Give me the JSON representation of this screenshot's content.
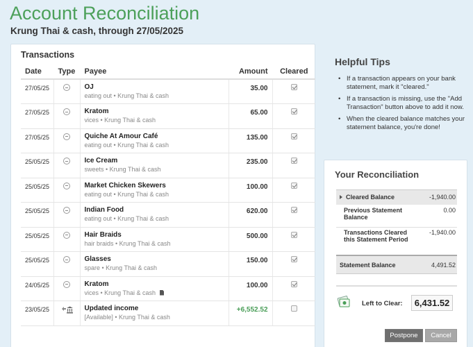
{
  "page": {
    "title": "Account Reconciliation",
    "subtitle": "Krung Thai & cash, through 27/05/2025"
  },
  "transactions": {
    "heading": "Transactions",
    "columns": {
      "date": "Date",
      "type": "Type",
      "payee": "Payee",
      "amount": "Amount",
      "cleared": "Cleared"
    },
    "rows": [
      {
        "date": "27/05/25",
        "type_icon": "minus-circle-icon",
        "payee": "OJ",
        "meta": "eating out • Krung Thai & cash",
        "amount": "35.00",
        "cleared": true
      },
      {
        "date": "27/05/25",
        "type_icon": "minus-circle-icon",
        "payee": "Kratom",
        "meta": "vices • Krung Thai & cash",
        "amount": "65.00",
        "cleared": true
      },
      {
        "date": "27/05/25",
        "type_icon": "minus-circle-icon",
        "payee": "Quiche At Amour Café",
        "meta": "eating out • Krung Thai & cash",
        "amount": "135.00",
        "cleared": true
      },
      {
        "date": "25/05/25",
        "type_icon": "minus-circle-icon",
        "payee": "Ice Cream",
        "meta": "sweets • Krung Thai & cash",
        "amount": "235.00",
        "cleared": true
      },
      {
        "date": "25/05/25",
        "type_icon": "minus-circle-icon",
        "payee": "Market Chicken Skewers",
        "meta": "eating out • Krung Thai & cash",
        "amount": "100.00",
        "cleared": true
      },
      {
        "date": "25/05/25",
        "type_icon": "minus-circle-icon",
        "payee": "Indian Food",
        "meta": "eating out • Krung Thai & cash",
        "amount": "620.00",
        "cleared": true
      },
      {
        "date": "25/05/25",
        "type_icon": "minus-circle-icon",
        "payee": "Hair Braids",
        "meta": "hair braids • Krung Thai & cash",
        "amount": "500.00",
        "cleared": true
      },
      {
        "date": "25/05/25",
        "type_icon": "minus-circle-icon",
        "payee": "Glasses",
        "meta": "spare • Krung Thai & cash",
        "amount": "150.00",
        "cleared": true
      },
      {
        "date": "24/05/25",
        "type_icon": "minus-circle-icon",
        "payee": "Kratom",
        "meta": "vices • Krung Thai & cash",
        "amount": "100.00",
        "cleared": true,
        "attachment_icon": "document-icon"
      },
      {
        "date": "23/05/25",
        "type_icon": "income-bank-icon",
        "payee": "Updated income",
        "meta": "[Available] • Krung Thai & cash",
        "amount": "+6,552.52",
        "cleared": false,
        "positive": true
      }
    ]
  },
  "tips": {
    "title": "Helpful Tips",
    "items": [
      "If a transaction appears on your bank statement, mark it \"cleared.\"",
      "If a transaction is missing, use the \"Add Transaction\" button above to add it now.",
      "When the cleared balance matches your statement balance, you're done!"
    ]
  },
  "reconciliation": {
    "title": "Your Reconciliation",
    "cleared_balance_label": "Cleared Balance",
    "cleared_balance_value": "-1,940.00",
    "previous_statement_label": "Previous Statement Balance",
    "previous_statement_value": "0.00",
    "period_label": "Transactions Cleared this Statement Period",
    "period_value": "-1,940.00",
    "statement_balance_label": "Statement Balance",
    "statement_balance_value": "4,491.52",
    "left_to_clear_label": "Left to Clear:",
    "left_to_clear_value": "6,431.52",
    "left_to_clear_icon": "money-stack-icon"
  },
  "buttons": {
    "postpone": "Postpone",
    "cancel": "Cancel"
  },
  "colors": {
    "title_green": "#4ca05a",
    "positive_green": "#4a9e58",
    "background": "#e3eff7"
  }
}
